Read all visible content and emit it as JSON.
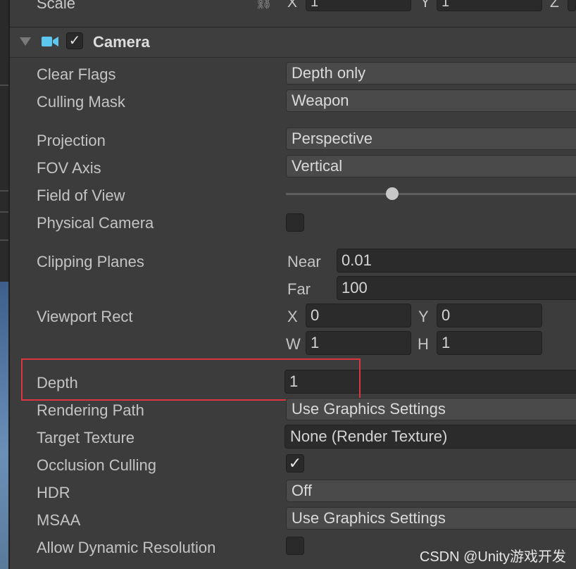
{
  "transform": {
    "scale_label": "Scale",
    "x_label": "X",
    "x_value": "1",
    "y_label": "Y",
    "y_value": "1",
    "z_label": "Z"
  },
  "component": {
    "title": "Camera",
    "enabled": true
  },
  "fields": {
    "clear_flags": {
      "label": "Clear Flags",
      "value": "Depth only"
    },
    "culling_mask": {
      "label": "Culling Mask",
      "value": "Weapon"
    },
    "projection": {
      "label": "Projection",
      "value": "Perspective"
    },
    "fov_axis": {
      "label": "FOV Axis",
      "value": "Vertical"
    },
    "field_of_view": {
      "label": "Field of View"
    },
    "physical_camera": {
      "label": "Physical Camera",
      "checked": false
    },
    "clipping_planes": {
      "label": "Clipping Planes",
      "near_label": "Near",
      "near_value": "0.01",
      "far_label": "Far",
      "far_value": "100"
    },
    "viewport_rect": {
      "label": "Viewport Rect",
      "x_label": "X",
      "x_value": "0",
      "y_label": "Y",
      "y_value": "0",
      "w_label": "W",
      "w_value": "1",
      "h_label": "H",
      "h_value": "1"
    },
    "depth": {
      "label": "Depth",
      "value": "1"
    },
    "rendering_path": {
      "label": "Rendering Path",
      "value": "Use Graphics Settings"
    },
    "target_texture": {
      "label": "Target Texture",
      "value": "None (Render Texture)"
    },
    "occlusion_culling": {
      "label": "Occlusion Culling",
      "checked": true
    },
    "hdr": {
      "label": "HDR",
      "value": "Off"
    },
    "msaa": {
      "label": "MSAA",
      "value": "Use Graphics Settings"
    },
    "allow_dynamic_resolution": {
      "label": "Allow Dynamic Resolution",
      "checked": false
    }
  },
  "watermark": "CSDN @Unity游戏开发",
  "colors": {
    "panel": "#3c3c3c",
    "field_dark": "#2b2b2b",
    "dropdown": "#4a4a4a",
    "highlight": "#d9363e",
    "camera_icon": "#5cc8f0"
  },
  "icons": {
    "fold": "triangle-down-icon",
    "camera": "video-camera-icon",
    "check": "checkmark-icon",
    "link": "link-icon"
  },
  "checkmark": "✓"
}
